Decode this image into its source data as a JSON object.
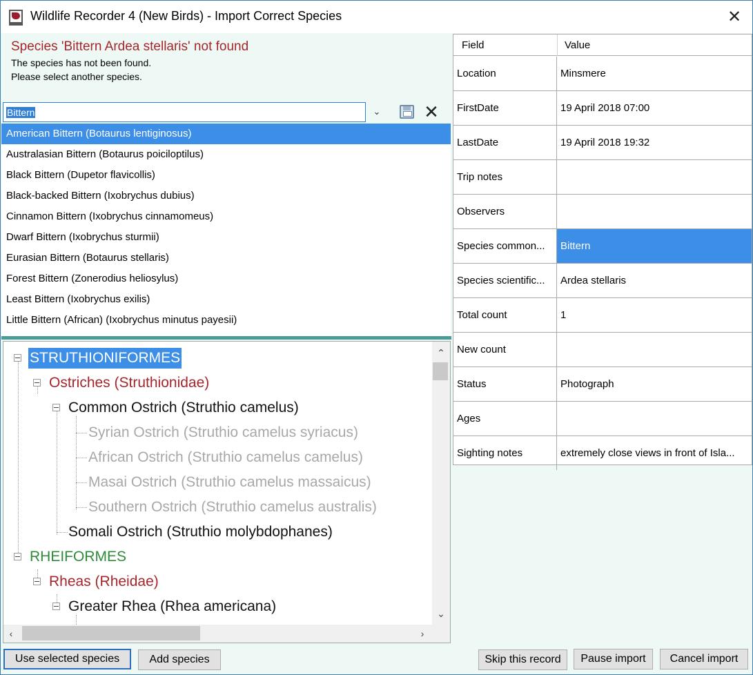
{
  "window": {
    "title": "Wildlife Recorder 4 (New Birds) - Import Correct Species",
    "close_glyph": "✕"
  },
  "message": {
    "title": "Species 'Bittern Ardea stellaris' not found",
    "line1": "The species has not been found.",
    "line2": "Please select another species."
  },
  "search": {
    "value": "Bittern",
    "dropdown_glyph": "⌄",
    "clear_glyph": "✕"
  },
  "species_list": [
    "American Bittern (Botaurus lentiginosus)",
    "Australasian Bittern (Botaurus poiciloptilus)",
    "Black Bittern (Dupetor flavicollis)",
    "Black-backed Bittern (Ixobrychus dubius)",
    "Cinnamon Bittern (Ixobrychus cinnamomeus)",
    "Dwarf Bittern (Ixobrychus sturmii)",
    "Eurasian Bittern (Botaurus stellaris)",
    "Forest Bittern (Zonerodius heliosylus)",
    "Least Bittern (Ixobrychus exilis)",
    "Little Bittern (African) (Ixobrychus minutus payesii)"
  ],
  "tree": {
    "order1": "STRUTHIONIFORMES",
    "family1": "Ostriches (Struthionidae)",
    "species1": "Common Ostrich (Struthio camelus)",
    "sub1": "Syrian Ostrich (Struthio camelus syriacus)",
    "sub2": "African Ostrich (Struthio camelus camelus)",
    "sub3": "Masai Ostrich (Struthio camelus massaicus)",
    "sub4": "Southern Ostrich (Struthio camelus australis)",
    "species2": "Somali Ostrich (Struthio molybdophanes)",
    "order2": "RHEIFORMES",
    "family2": "Rheas (Rheidae)",
    "species3": "Greater Rhea (Rhea americana)"
  },
  "grid": {
    "header_field": "Field",
    "header_value": "Value",
    "rows": [
      {
        "field": "Location",
        "value": "Minsmere"
      },
      {
        "field": "FirstDate",
        "value": "19 April 2018 07:00"
      },
      {
        "field": "LastDate",
        "value": "19 April 2018 19:32"
      },
      {
        "field": "Trip notes",
        "value": ""
      },
      {
        "field": "Observers",
        "value": ""
      },
      {
        "field": "Species common...",
        "value": "Bittern"
      },
      {
        "field": "Species scientific...",
        "value": "Ardea stellaris"
      },
      {
        "field": "Total count",
        "value": "1"
      },
      {
        "field": "New count",
        "value": ""
      },
      {
        "field": "Status",
        "value": "Photograph"
      },
      {
        "field": "Ages",
        "value": ""
      },
      {
        "field": "Sighting notes",
        "value": "extremely close views in front of Isla..."
      }
    ]
  },
  "buttons": {
    "use_selected": "Use selected species",
    "add_species": "Add species",
    "skip_record": "Skip this record",
    "pause_import": "Pause import",
    "cancel_import": "Cancel import"
  },
  "colors": {
    "selection": "#3d8ee6",
    "error_red": "#a4262c",
    "family_red": "#a4262c",
    "order_green": "#2e8b3a",
    "subspecies_grey": "#a8a8a8"
  }
}
